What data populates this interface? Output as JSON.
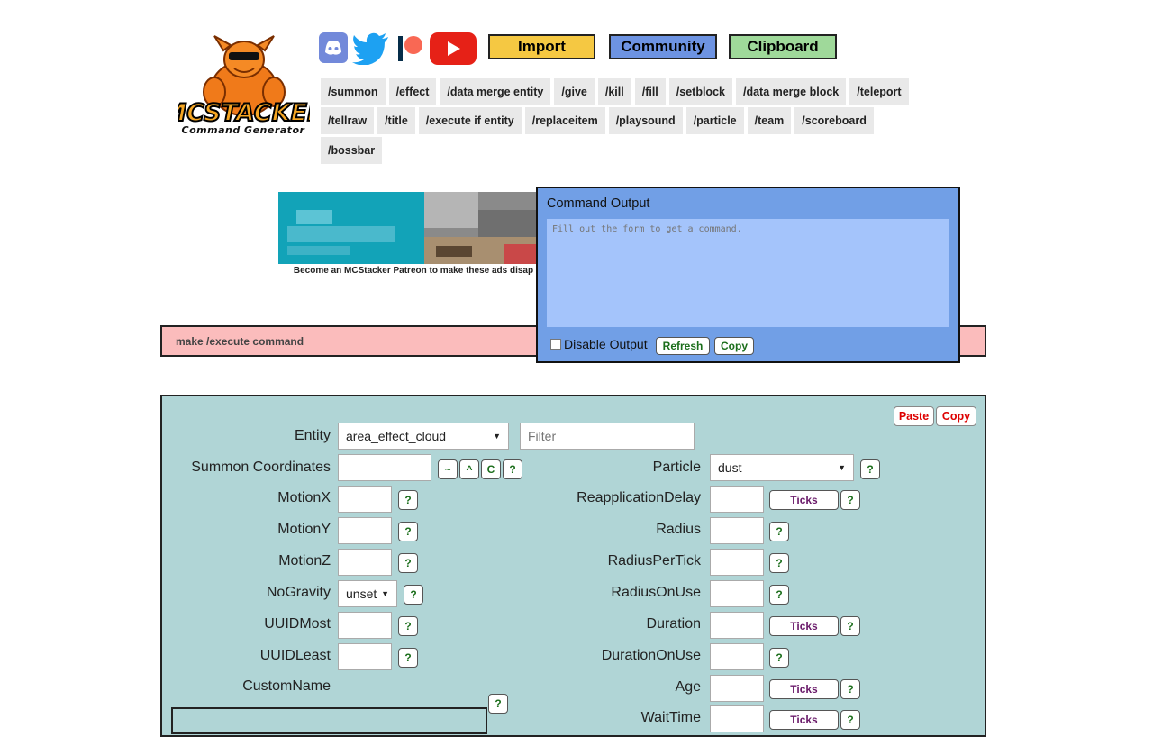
{
  "logo": {
    "title": "MCSTACKER",
    "subtitle": "Command Generator"
  },
  "social": {
    "discord_icon": "discord-icon",
    "twitter_icon": "twitter-icon",
    "patreon_icon": "patreon-icon",
    "youtube_icon": "youtube-icon"
  },
  "topbar": {
    "import_label": "Import",
    "community_label": "Community",
    "clipboard_label": "Clipboard",
    "colors": {
      "import": "#f5c842",
      "community": "#6d93e2",
      "clipboard": "#9fd99a"
    }
  },
  "nav": {
    "row1": [
      "/summon",
      "/effect",
      "/data merge entity",
      "/give",
      "/kill",
      "/fill",
      "/setblock",
      "/data merge block",
      "/teleport"
    ],
    "row2": [
      "/tellraw",
      "/title",
      "/execute if entity",
      "/replaceitem",
      "/playsound",
      "/particle",
      "/team",
      "/scoreboard"
    ],
    "row3": [
      "/bossbar"
    ]
  },
  "ad": {
    "note": "Become an MCStacker Patreon to make these ads disap"
  },
  "pinkbar": {
    "text": "make /execute command"
  },
  "output": {
    "title": "Command Output",
    "placeholder": "Fill out the form to get a command.",
    "disable_label": "Disable Output",
    "refresh_label": "Refresh",
    "copy_label": "Copy"
  },
  "form": {
    "paste_label": "Paste",
    "copy_label": "Copy",
    "entity_label": "Entity",
    "entity_value": "area_effect_cloud",
    "filter_placeholder": "Filter",
    "coords_label": "Summon Coordinates",
    "coord_buttons": [
      "~",
      "^",
      "C"
    ],
    "help": "?",
    "ticks_label": "Ticks",
    "left_fields": {
      "motionx": "MotionX",
      "motiony": "MotionY",
      "motionz": "MotionZ",
      "nogravity": "NoGravity",
      "nogravity_value": "unset",
      "uuidmost": "UUIDMost",
      "uuidleast": "UUIDLeast",
      "customname": "CustomName"
    },
    "right_fields": {
      "particle": "Particle",
      "particle_value": "dust",
      "reapplicationdelay": "ReapplicationDelay",
      "radius": "Radius",
      "radiuspertick": "RadiusPerTick",
      "radiusonuse": "RadiusOnUse",
      "duration": "Duration",
      "durationonuse": "DurationOnUse",
      "age": "Age",
      "waittime": "WaitTime"
    }
  }
}
